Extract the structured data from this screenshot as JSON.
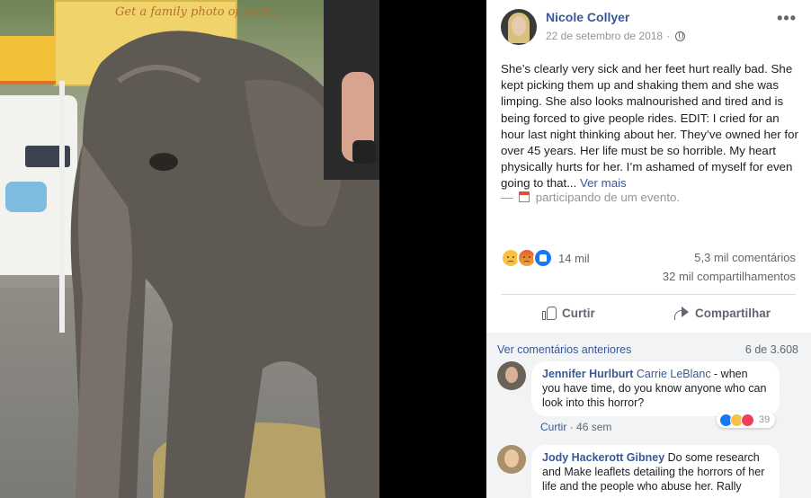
{
  "photo": {
    "sign_text": "Get a family photo of your...",
    "alt_subject": "elephant"
  },
  "post": {
    "author": "Nicole Collyer",
    "date": "22 de setembro de 2018",
    "separator": "·",
    "more_icon": "•••",
    "body": "She’s clearly very sick and her feet hurt really bad. She kept picking them up and shaking them and she was limping. She also looks malnourished and tired and is being forced to give people rides. EDIT: I cried for an hour last night thinking about her. They’ve owned her for over 45 years. Her life must be so horrible. My heart physically hurts for her. I’m ashamed of myself for even going to that...",
    "see_more": "Ver mais",
    "event_prefix": "—",
    "event_text": "participando de um evento."
  },
  "stats": {
    "reaction_count": "14 mil",
    "reaction_types": [
      "sad-reaction-icon",
      "angry-reaction-icon",
      "like-reaction-icon"
    ],
    "comments": "5,3 mil comentários",
    "shares": "32 mil compartilhamentos"
  },
  "actions": {
    "like": "Curtir",
    "share": "Compartilhar"
  },
  "comments_section": {
    "previous_link": "Ver comentários anteriores",
    "page_count": "6 de 3.608",
    "comments": [
      {
        "name": "Jennifer Hurlburt",
        "tag": "Carrie LeBlanc",
        "text": " - when you have time, do you know anyone who can look into this horror?",
        "like_label": "Curtir",
        "separator": "·",
        "time": "46 sem",
        "reaction_count": "39"
      },
      {
        "name": "Jody Hackerott Gibney",
        "text": " Do some research and Make leaflets detailing the horrors of her life and the people who abuse her. Rally"
      }
    ]
  },
  "colors": {
    "link_blue": "#385898",
    "muted_gray": "#606770",
    "divider": "#dadde1",
    "comment_bg": "#f2f3f5"
  }
}
